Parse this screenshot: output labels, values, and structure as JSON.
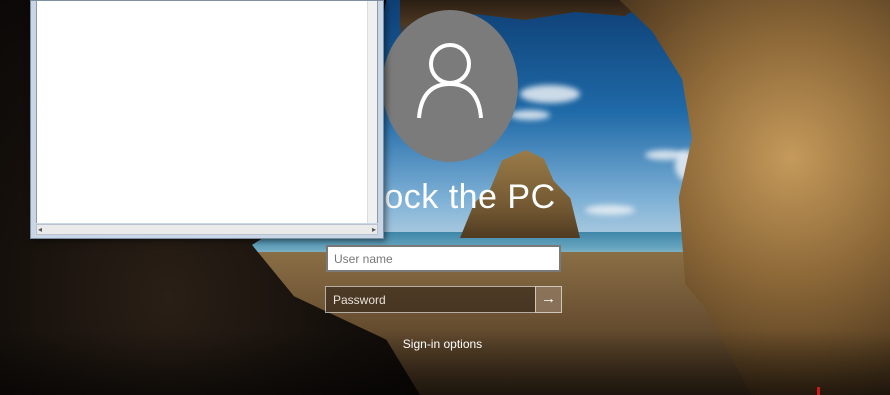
{
  "lock_screen": {
    "title": "ock the PC",
    "username_placeholder": "User name",
    "password_placeholder": "Password",
    "submit_glyph": "→",
    "signin_options": "Sign-in options",
    "avatar_icon": "user-silhouette-icon"
  },
  "overlay_window": {
    "scroll_left_glyph": "◂",
    "scroll_right_glyph": "▸"
  },
  "colors": {
    "avatar_bg": "#7b7b7b",
    "text": "#ffffff",
    "input_bg": "#ffffff"
  }
}
